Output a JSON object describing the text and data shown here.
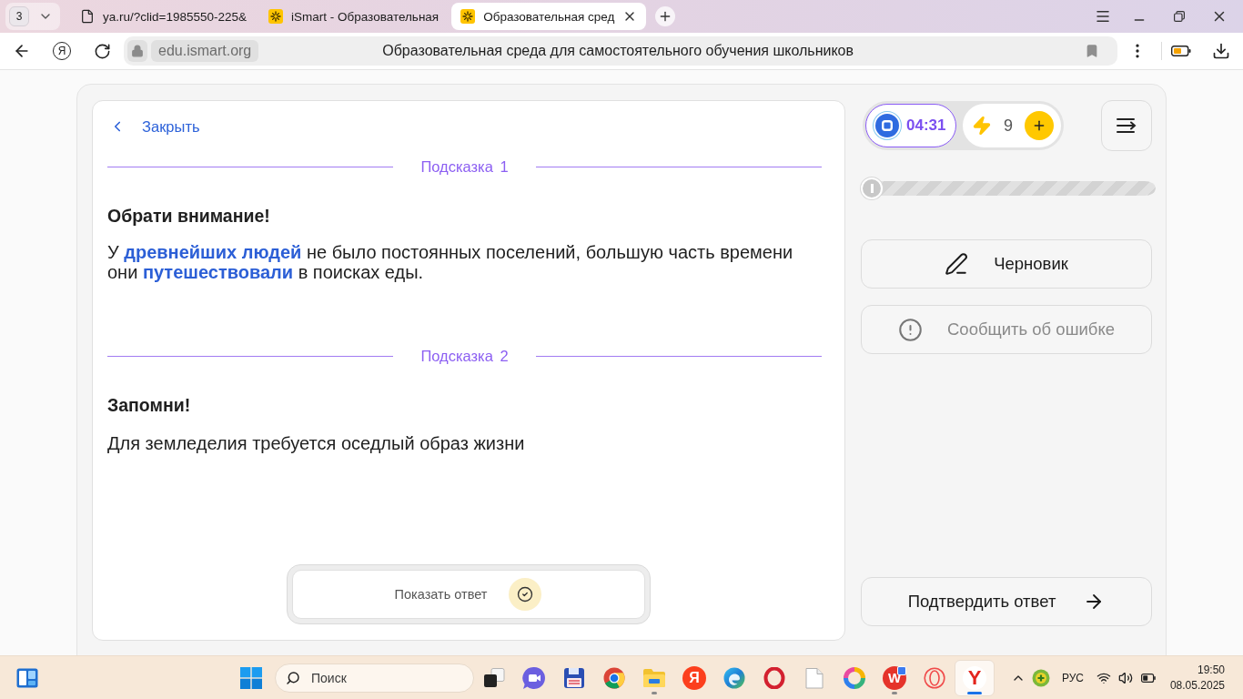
{
  "browser": {
    "tab_counter": "3",
    "tabs": [
      {
        "kind": "page",
        "title": "ya.ru/?clid=1985550-225&",
        "selected": false
      },
      {
        "kind": "ismart",
        "title": "iSmart - Образовательная",
        "selected": false
      },
      {
        "kind": "ismart",
        "title": "Образовательная сред",
        "selected": true
      }
    ],
    "toolbar": {
      "home_glyph": "Я",
      "domain": "edu.ismart.org",
      "page_title": "Образовательная среда для самостоятельного обучения школьников"
    }
  },
  "task": {
    "close_label": "Закрыть",
    "hints": [
      {
        "label": "Подсказка 1",
        "heading": "Обрати внимание!",
        "text": "У **древнейших людей** не было постоянных поселений, большую часть времени они **путешествовали** в поисках еды."
      },
      {
        "label": "Подсказка 2",
        "heading": "Запомни!",
        "text": "Для земледелия требуется оседлый образ жизни"
      }
    ],
    "show_answer": "Показать ответ"
  },
  "sidebar": {
    "timer": "04:31",
    "energy": "9",
    "progress": {
      "level": 0
    },
    "actions": [
      {
        "kind": "draft",
        "label": "Черновик",
        "disabled": false
      },
      {
        "kind": "report",
        "label": "Сообщить об ошибке",
        "disabled": true
      }
    ],
    "submit": "Подтвердить ответ"
  },
  "taskbar": {
    "search_placeholder": "Поиск",
    "apps": [
      {
        "kind": "task-view",
        "running": false,
        "selected": false
      },
      {
        "kind": "meet",
        "running": false,
        "selected": false
      },
      {
        "kind": "floppy",
        "running": false,
        "selected": false
      },
      {
        "kind": "chrome",
        "running": false,
        "selected": false
      },
      {
        "kind": "folder",
        "running": true,
        "selected": false
      },
      {
        "kind": "yandex",
        "glyph": "Я",
        "running": false,
        "selected": false
      },
      {
        "kind": "edge",
        "running": false,
        "selected": false
      },
      {
        "kind": "opera",
        "running": false,
        "selected": false
      },
      {
        "kind": "file",
        "running": false,
        "selected": false
      },
      {
        "kind": "photos",
        "running": false,
        "selected": false
      },
      {
        "kind": "wps",
        "glyph": "W",
        "running": true,
        "selected": false
      },
      {
        "kind": "opera-gx",
        "running": false,
        "selected": false
      },
      {
        "kind": "yandex-browser",
        "glyph": "Y",
        "running": true,
        "selected": true
      }
    ],
    "language": "РУС",
    "time": "19:50",
    "date": "08.05.2025"
  }
}
